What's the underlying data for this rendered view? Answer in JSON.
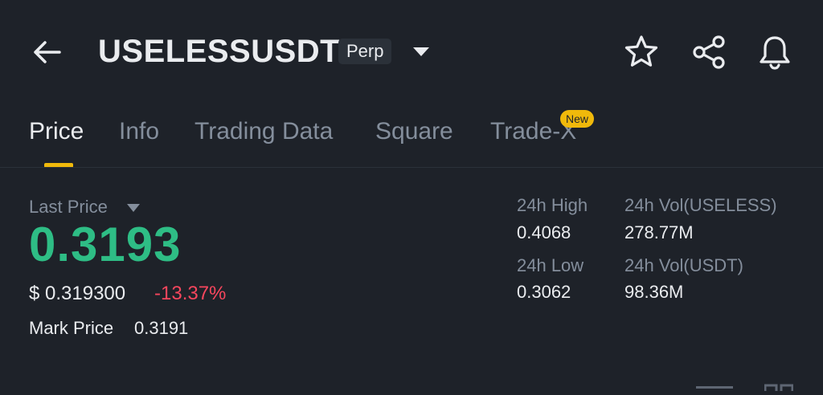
{
  "header": {
    "symbol": "USELESSUSDT",
    "contract_type": "Perp",
    "icons": [
      "back-arrow-icon",
      "chevron-down-icon",
      "star-icon",
      "share-icon",
      "bell-icon"
    ]
  },
  "tabs": [
    {
      "label": "Price",
      "active": true
    },
    {
      "label": "Info",
      "active": false
    },
    {
      "label": "Trading Data",
      "active": false
    },
    {
      "label": "Square",
      "active": false
    },
    {
      "label": "Trade-X",
      "active": false,
      "badge": "New"
    }
  ],
  "price": {
    "last_price_label": "Last Price",
    "last_price": "0.3193",
    "usd_price": "$ 0.319300",
    "change_pct": "-13.37%",
    "mark_price_label": "Mark Price",
    "mark_price": "0.3191"
  },
  "stats": {
    "high_label": "24h High",
    "high_value": "0.4068",
    "low_label": "24h Low",
    "low_value": "0.3062",
    "vol_base_label": "24h Vol(USELESS)",
    "vol_base_value": "278.77M",
    "vol_quote_label": "24h Vol(USDT)",
    "vol_quote_value": "98.36M"
  },
  "colors": {
    "background": "#1e2229",
    "accent": "#f0b90b",
    "up": "#2ebd85",
    "down": "#f6465d",
    "muted": "#848e9c",
    "text": "#eaecef"
  }
}
